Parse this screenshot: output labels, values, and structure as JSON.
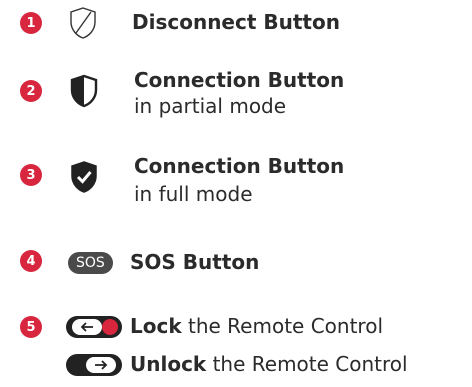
{
  "items": [
    {
      "number": "1",
      "icon": "shield-outline-icon",
      "title": "Disconnect Button",
      "subtitle": ""
    },
    {
      "number": "2",
      "icon": "shield-half-icon",
      "title": "Connection Button",
      "subtitle": "in partial mode"
    },
    {
      "number": "3",
      "icon": "shield-check-icon",
      "title": "Connection Button",
      "subtitle": "in full mode"
    },
    {
      "number": "4",
      "icon": "sos-button-icon",
      "title": "SOS Button",
      "subtitle": "",
      "badge": "SOS"
    },
    {
      "number": "5",
      "icon": "lock-toggle-icon",
      "lock_bold": "Lock",
      "lock_rest": " the Remote Control",
      "unlock_bold": "Unlock",
      "unlock_rest": " the Remote Control"
    }
  ],
  "colors": {
    "accent": "#d7263d",
    "dark": "#222222",
    "text": "#2b2b2b"
  }
}
